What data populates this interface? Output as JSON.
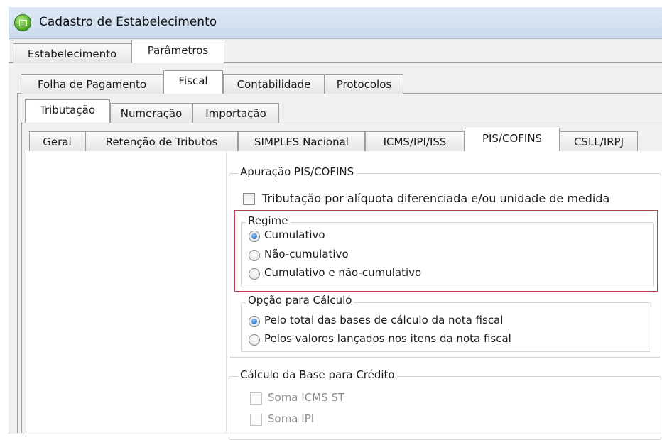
{
  "window": {
    "title": "Cadastro de Estabelecimento"
  },
  "tabs_level1": [
    {
      "label": "Estabelecimento",
      "active": false
    },
    {
      "label": "Parâmetros",
      "active": true
    }
  ],
  "tabs_level2": [
    {
      "label": "Folha de Pagamento",
      "active": false
    },
    {
      "label": "Fiscal",
      "active": true
    },
    {
      "label": "Contabilidade",
      "active": false
    },
    {
      "label": "Protocolos",
      "active": false
    }
  ],
  "tabs_level3": [
    {
      "label": "Tributação",
      "active": true
    },
    {
      "label": "Numeração",
      "active": false
    },
    {
      "label": "Importação",
      "active": false
    }
  ],
  "tabs_level4": [
    {
      "label": "Geral",
      "active": false
    },
    {
      "label": "Retenção de Tributos",
      "active": false
    },
    {
      "label": "SIMPLES Nacional",
      "active": false
    },
    {
      "label": "ICMS/IPI/ISS",
      "active": false
    },
    {
      "label": "PIS/COFINS",
      "active": true
    },
    {
      "label": "CSLL/IRPJ",
      "active": false
    }
  ],
  "apuracao": {
    "title": "Apuração PIS/COFINS",
    "aliquota_checkbox": {
      "label": "Tributação por alíquota diferenciada e/ou unidade de medida",
      "checked": false
    },
    "regime": {
      "title": "Regime",
      "options": [
        {
          "label": "Cumulativo",
          "selected": true
        },
        {
          "label": "Não-cumulativo",
          "selected": false
        },
        {
          "label": "Cumulativo e não-cumulativo",
          "selected": false
        }
      ]
    },
    "opcao_calculo": {
      "title": "Opção para Cálculo",
      "options": [
        {
          "label": "Pelo total das bases de cálculo da nota fiscal",
          "selected": true
        },
        {
          "label": "Pelos valores lançados nos itens da nota fiscal",
          "selected": false
        }
      ]
    }
  },
  "base_credito": {
    "title": "Cálculo da Base para Crédito",
    "options": [
      {
        "label": "Soma ICMS ST",
        "checked": false,
        "enabled": false
      },
      {
        "label": "Soma IPI",
        "checked": false,
        "enabled": false
      }
    ]
  },
  "colors": {
    "highlight": "#b3424a",
    "titlebar": "#c9d9ec"
  }
}
